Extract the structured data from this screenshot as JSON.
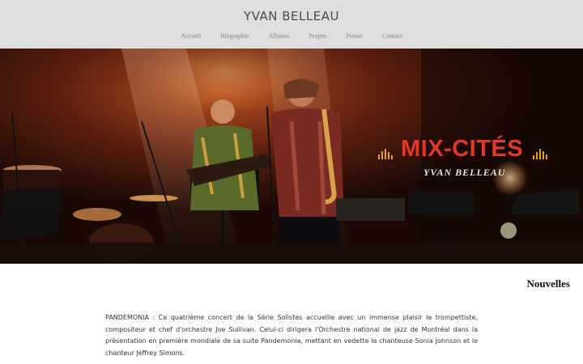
{
  "site": {
    "title": "YVAN BELLEAU"
  },
  "nav": [
    {
      "label": "Accueil"
    },
    {
      "label": "Biographie"
    },
    {
      "label": "Albums"
    },
    {
      "label": "Projets"
    },
    {
      "label": "Presse"
    },
    {
      "label": "Contact"
    }
  ],
  "hero": {
    "title": "MIX-CITÉS",
    "subtitle": "YVAN BELLEAU",
    "accent_color": "#e2382c",
    "subtitle_color": "#f1e5d6"
  },
  "news": {
    "heading": "Nouvelles",
    "body": "PANDEMONIA : Ce quatrième concert de la Série Solistes accueille avec un immense plaisir le trompettiste, compositeur et chef d'orchestre Joe Sullivan. Celui-ci dirigera l'Orchestre national de jazz de Montréal dans la présentation en première mondiale de sa suite Pandemonia, mettant en vedette la chanteuse Sonia Johnson et le chanteur Jeffrey Simons."
  }
}
